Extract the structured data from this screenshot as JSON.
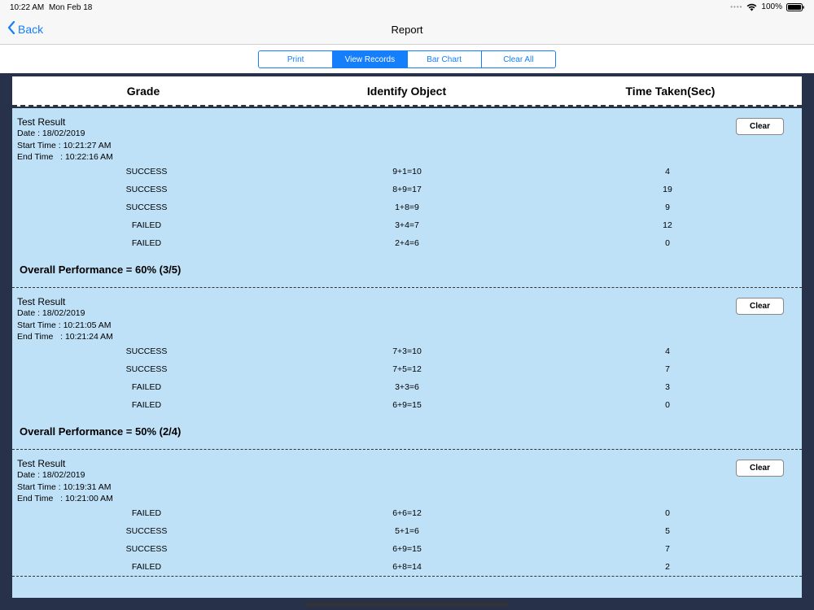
{
  "status_bar": {
    "time": "10:22 AM",
    "date": "Mon Feb 18",
    "battery": "100%"
  },
  "nav": {
    "back_label": "Back",
    "title": "Report"
  },
  "segments": [
    {
      "label": "Print",
      "active": false
    },
    {
      "label": "View Records",
      "active": true
    },
    {
      "label": "Bar Chart",
      "active": false
    },
    {
      "label": "Clear All",
      "active": false
    }
  ],
  "table": {
    "headers": [
      "Grade",
      "Identify Object",
      "Time Taken(Sec)"
    ]
  },
  "records": [
    {
      "title": "Test Result",
      "date": "Date : 18/02/2019",
      "start": "Start Time : 10:21:27 AM",
      "end": "End Time   : 10:22:16 AM",
      "clear_label": "Clear",
      "rows": [
        [
          "SUCCESS",
          "9+1=10",
          "4"
        ],
        [
          "SUCCESS",
          "8+9=17",
          "19"
        ],
        [
          "SUCCESS",
          "1+8=9",
          "9"
        ],
        [
          "FAILED",
          "3+4=7",
          "12"
        ],
        [
          "FAILED",
          "2+4=6",
          "0"
        ]
      ],
      "overall": "Overall Performance = 60% (3/5)"
    },
    {
      "title": "Test Result",
      "date": "Date : 18/02/2019",
      "start": "Start Time : 10:21:05 AM",
      "end": "End Time   : 10:21:24 AM",
      "clear_label": "Clear",
      "rows": [
        [
          "SUCCESS",
          "7+3=10",
          "4"
        ],
        [
          "SUCCESS",
          "7+5=12",
          "7"
        ],
        [
          "FAILED",
          "3+3=6",
          "3"
        ],
        [
          "FAILED",
          "6+9=15",
          "0"
        ]
      ],
      "overall": "Overall Performance = 50% (2/4)"
    },
    {
      "title": "Test Result",
      "date": "Date : 18/02/2019",
      "start": "Start Time : 10:19:31 AM",
      "end": "End Time   : 10:21:00 AM",
      "clear_label": "Clear",
      "rows": [
        [
          "FAILED",
          "6+6=12",
          "0"
        ],
        [
          "SUCCESS",
          "5+1=6",
          "5"
        ],
        [
          "SUCCESS",
          "6+9=15",
          "7"
        ],
        [
          "FAILED",
          "6+8=14",
          "2"
        ]
      ],
      "overall": ""
    }
  ],
  "colors": {
    "accent": "#147efb",
    "record_bg": "#bfe1f7",
    "frame": "#27324a"
  }
}
